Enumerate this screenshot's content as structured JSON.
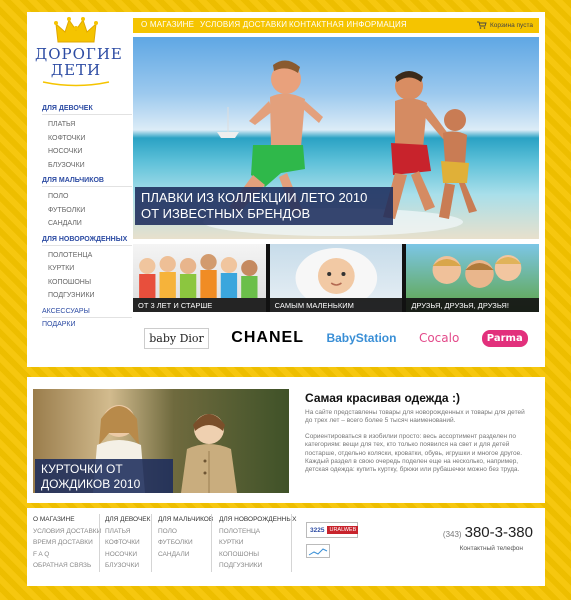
{
  "logo": {
    "line1": "ДОРОГИЕ",
    "line2": "ДЕТИ"
  },
  "nav": {
    "items": [
      "О МАГАЗИНЕ",
      "УСЛОВИЯ ДОСТАВКИ",
      "КОНТАКТНАЯ ИНФОРМАЦИЯ"
    ],
    "cart": "Корзина пуста"
  },
  "sidebar": {
    "girls": {
      "title": "ДЛЯ ДЕВОЧЕК",
      "items": [
        "ПЛАТЬЯ",
        "КОФТОЧКИ",
        "НОСОЧКИ",
        "БЛУЗОЧКИ"
      ]
    },
    "boys": {
      "title": "ДЛЯ МАЛЬЧИКОВ",
      "items": [
        "ПОЛО",
        "ФУТБОЛКИ",
        "САНДАЛИ"
      ]
    },
    "newborn": {
      "title": "ДЛЯ НОВОРОЖДЕННЫХ",
      "items": [
        "ПОЛОТЕНЦА",
        "КУРТКИ",
        "КОПОШОНЫ",
        "ПОДГУЗНИКИ"
      ]
    },
    "accessories": "АКСЕССУАРЫ",
    "gifts": "ПОДАРКИ"
  },
  "hero": {
    "line1": "ПЛАВКИ ИЗ КОЛЛЕКЦИИ ЛЕТО 2010",
    "line2": "ОТ ИЗВЕСТНЫХ БРЕНДОВ"
  },
  "thumbs": [
    "ОТ 3 ЛЕТ И СТАРШЕ",
    "САМЫМ МАЛЕНЬКИМ",
    "ДРУЗЬЯ, ДРУЗЬЯ, ДРУЗЬЯ!"
  ],
  "brands": [
    "baby Dior",
    "CHANEL",
    "BabyStation",
    "Cocalo",
    "Parma"
  ],
  "promo": {
    "line1": "КУРТОЧКИ ОТ",
    "line2": "ДОЖДИКОВ 2010"
  },
  "about": {
    "title": "Самая красивая одежда :)",
    "p1": "На сайте представлены товары для новорожденных и товары для детей до трех лет – всего более 5 тысяч наименований.",
    "p2": "Сориентироваться в изобилии просто: весь ассортимент разделен по категориям: вещи для тех, кто только появился на свет и для детей постарше, отдельно коляски, кроватки, обувь, игрушки и многое другое. Каждый раздел в свою очередь поделен еще на несколько, например, детская одежда: купить куртку, брюки или рубашечки можно без труда."
  },
  "footer": {
    "col1": [
      "О МАГАЗИНЕ",
      "УСЛОВИЯ ДОСТАВКИ",
      "ВРЕМЯ ДОСТАВКИ",
      "F A Q",
      "ОБРАТНАЯ СВЯЗЬ"
    ],
    "col2": [
      "ДЛЯ ДЕВОЧЕК",
      "ПЛАТЬЯ",
      "КОФТОЧКИ",
      "НОСОЧКИ",
      "БЛУЗОЧКИ"
    ],
    "col3": [
      "ДЛЯ МАЛЬЧИКОВ",
      "ПОЛО",
      "ФУТБОЛКИ",
      "САНДАЛИ"
    ],
    "col4": [
      "ДЛЯ НОВОРОЖДЕННЫХ",
      "ПОЛОТЕНЦА",
      "КУРТКИ",
      "КОПОШОНЫ",
      "ПОДГУЗНИКИ"
    ],
    "counter": "3225",
    "badge": "URALWEB",
    "phone_code": "(343)",
    "phone": "380-3-380",
    "phone_label": "Контактный телефон"
  },
  "colors": {
    "accent": "#f5c400",
    "brand_blue": "#2c4ba3",
    "caption_bg": "#1c2c5c"
  }
}
